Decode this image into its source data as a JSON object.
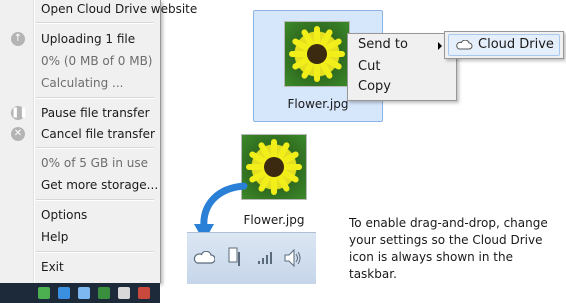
{
  "tray_menu": {
    "items": {
      "open_website": "Open Cloud Drive website",
      "uploading": "Uploading 1 file",
      "progress": "0% (0 MB of 0 MB)",
      "calculating": "Calculating ...",
      "pause": "Pause file transfer",
      "cancel": "Cancel file transfer",
      "storage_used": "0% of 5 GB in use",
      "get_storage": "Get more storage...",
      "options": "Options",
      "help": "Help",
      "exit": "Exit"
    }
  },
  "explorer": {
    "selected_file": "Flower.jpg",
    "context_menu": {
      "send_to": "Send to",
      "cut": "Cut",
      "copy": "Copy"
    },
    "submenu": {
      "cloud_drive": "Cloud Drive"
    }
  },
  "illustration": {
    "dragged_file": "Flower.jpg",
    "instruction": "To enable drag-and-drop, change your settings so the Cloud Drive icon is always shown in the taskbar."
  },
  "colors": {
    "menu_bg": "#f0f0f0",
    "selection_bg": "#d6e6fb",
    "arrow": "#2a7fd6"
  }
}
